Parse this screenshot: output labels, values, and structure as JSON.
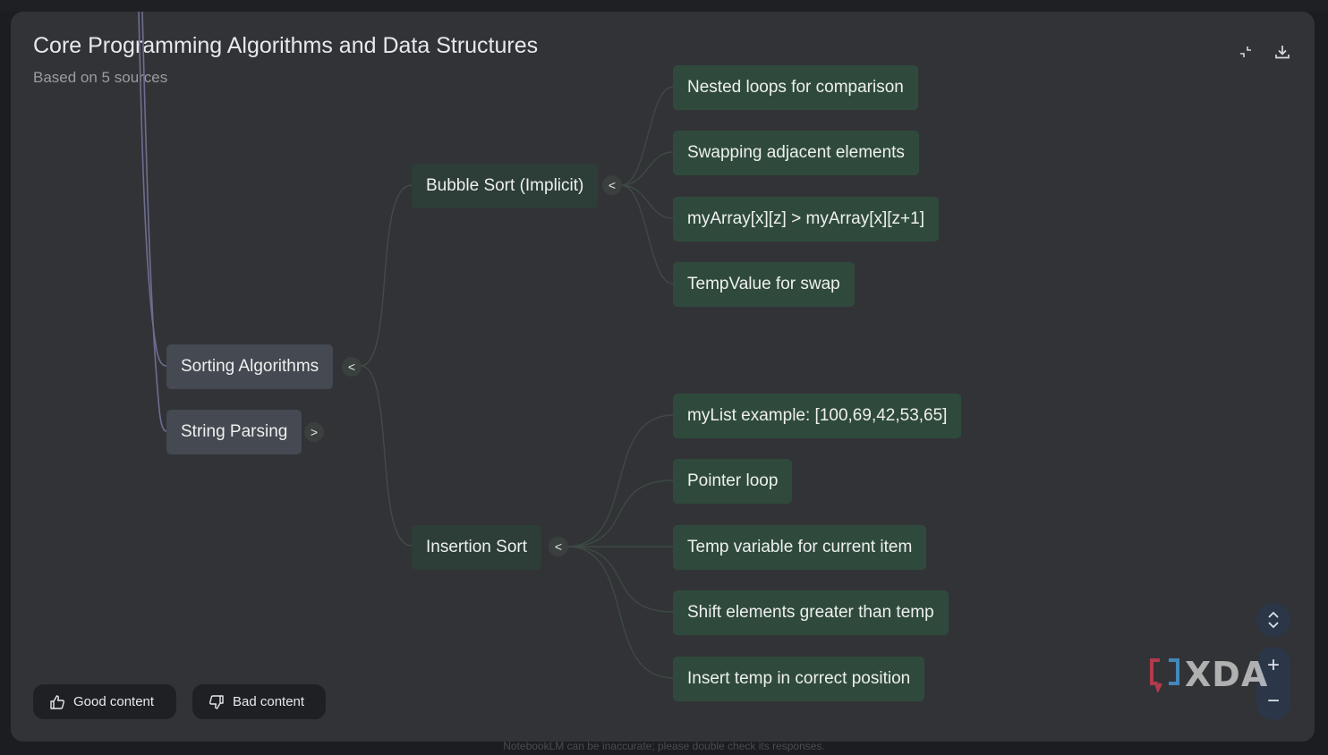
{
  "header": {
    "title": "Core Programming Algorithms and Data Structures",
    "subtitle": "Based on 5 sources",
    "collapse_icon": "collapse-icon",
    "download_icon": "download-icon"
  },
  "mindmap": {
    "level1": [
      {
        "label": "Sorting Algorithms",
        "toggle": "<"
      },
      {
        "label": "String Parsing",
        "toggle": ">"
      }
    ],
    "level2": [
      {
        "label": "Bubble Sort (Implicit)",
        "toggle": "<"
      },
      {
        "label": "Insertion Sort",
        "toggle": "<"
      }
    ],
    "bubble_children": [
      "Nested loops for comparison",
      "Swapping adjacent elements",
      "myArray[x][z] > myArray[x][z+1]",
      "TempValue for swap"
    ],
    "insertion_children": [
      "myList example: [100,69,42,53,65]",
      "Pointer loop",
      "Temp variable for current item",
      "Shift elements greater than temp",
      "Insert temp in correct position"
    ]
  },
  "feedback": {
    "good_label": "Good content",
    "bad_label": "Bad content",
    "good_icon": "thumbs-up-icon",
    "bad_icon": "thumbs-down-icon"
  },
  "controls": {
    "nav_icon": "expand-vertical-icon",
    "zoom_in": "+",
    "zoom_out": "−"
  },
  "watermark": {
    "text": "XDA"
  },
  "footer": {
    "disclaimer": "NotebookLM can be inaccurate; please double check its responses."
  },
  "colors": {
    "panel": "#323337",
    "node_level1": "#444952",
    "node_level2": "#2c3e37",
    "node_leaf": "#2f4a3c",
    "edge": "#3d4a44"
  }
}
